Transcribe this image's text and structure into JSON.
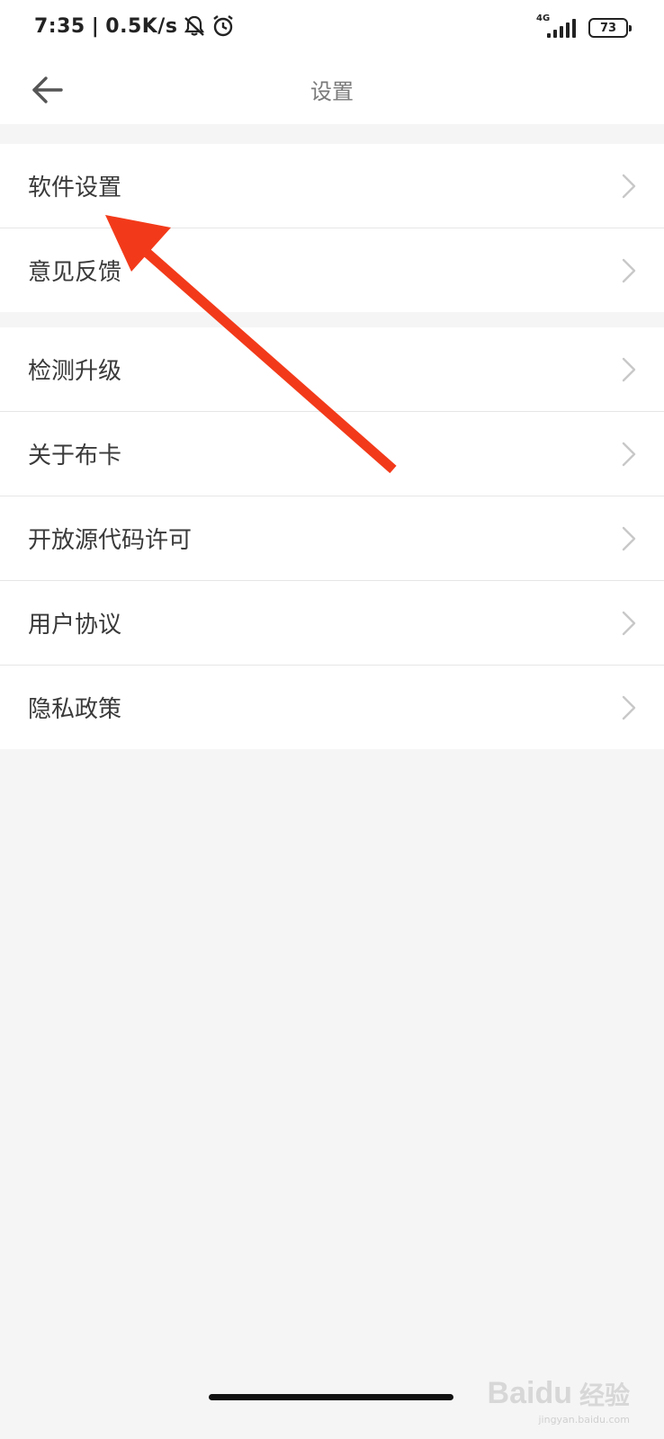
{
  "status_bar": {
    "time": "7:35",
    "separator": "|",
    "net_speed": "0.5K/s",
    "network_type": "4G",
    "battery": "73",
    "icons": [
      "muted-bell-icon",
      "alarm-clock-icon",
      "signal-icon",
      "battery-icon"
    ]
  },
  "header": {
    "title": "设置",
    "back_icon": "back-arrow-icon"
  },
  "settings": {
    "group1": [
      {
        "label": "软件设置"
      },
      {
        "label": "意见反馈"
      }
    ],
    "group2": [
      {
        "label": "检测升级"
      },
      {
        "label": "关于布卡"
      },
      {
        "label": "开放源代码许可"
      },
      {
        "label": "用户协议"
      },
      {
        "label": "隐私政策"
      }
    ]
  },
  "annotation": {
    "type": "red-arrow-icon",
    "color": "#f23a1a",
    "points_to": "软件设置"
  },
  "watermark": {
    "brand": "Baidu",
    "text": "经验",
    "url": "jingyan.baidu.com"
  },
  "colors": {
    "background": "#f5f5f5",
    "surface": "#ffffff",
    "divider": "#e6e6e6",
    "text_primary": "#3a3a3a",
    "text_title": "#7a7a7a",
    "chevron": "#c8c8c8",
    "arrow": "#f23a1a"
  }
}
